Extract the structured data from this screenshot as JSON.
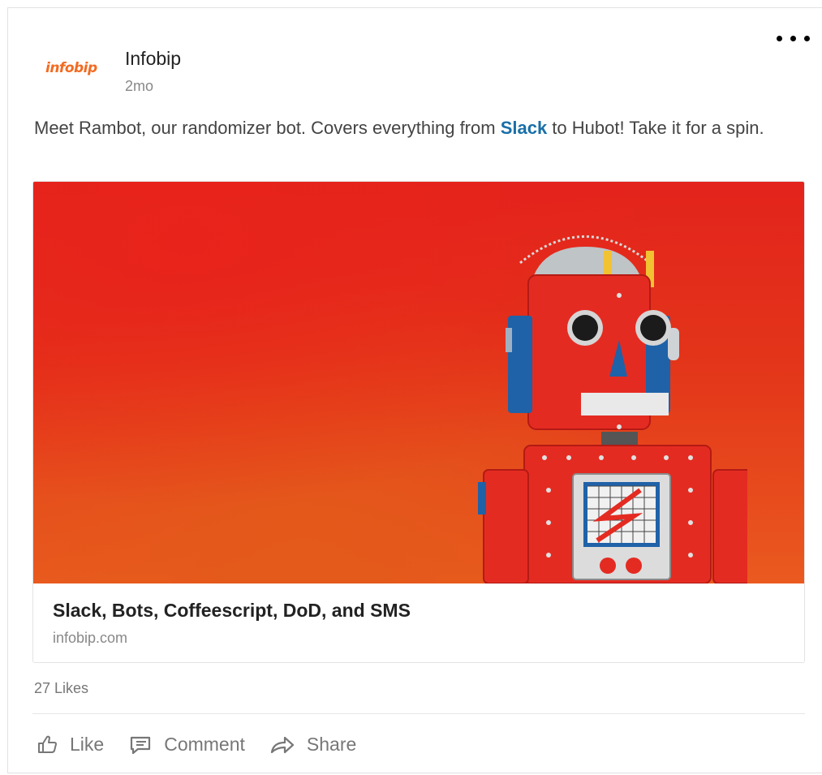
{
  "post": {
    "logo_text": "infobip",
    "author": "Infobip",
    "time": "2mo",
    "text_before": "Meet Rambot, our randomizer bot. Covers everything from ",
    "text_link": "Slack",
    "text_after": " to Hubot!  Take it for a spin.",
    "link_color": "#1a6fa8"
  },
  "link_preview": {
    "title": "Slack, Bots, Coffeescript, DoD, and SMS",
    "domain": "infobip.com",
    "image_desc": "red toy robot on red background"
  },
  "social": {
    "likes": "27 Likes"
  },
  "actions": {
    "like": "Like",
    "comment": "Comment",
    "share": "Share"
  },
  "icons": {
    "more": "more-options-icon",
    "like": "thumbs-up-icon",
    "comment": "comment-icon",
    "share": "share-arrow-icon"
  },
  "colors": {
    "brand": "#f26b22",
    "hero_background": "#e3231c"
  }
}
